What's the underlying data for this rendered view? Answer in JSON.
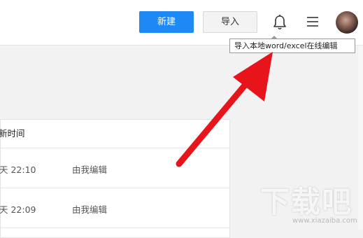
{
  "header": {
    "new_label": "新建",
    "import_label": "导入",
    "bell_icon": "bell-icon",
    "menu_icon": "menu-icon"
  },
  "tooltip": {
    "text": "导入本地word/excel在线编辑"
  },
  "table": {
    "header_partial": "新时间",
    "rows": [
      {
        "time": "天 22:10",
        "editor": "由我编辑"
      },
      {
        "time": "天 22:09",
        "editor": "由我编辑"
      }
    ]
  },
  "watermark": {
    "main": "下载吧",
    "url": "www.xiazaiba.com"
  },
  "colors": {
    "primary_blue": "#1e88f5",
    "arrow_red": "#e8141c",
    "background": "#f2f2f2"
  }
}
